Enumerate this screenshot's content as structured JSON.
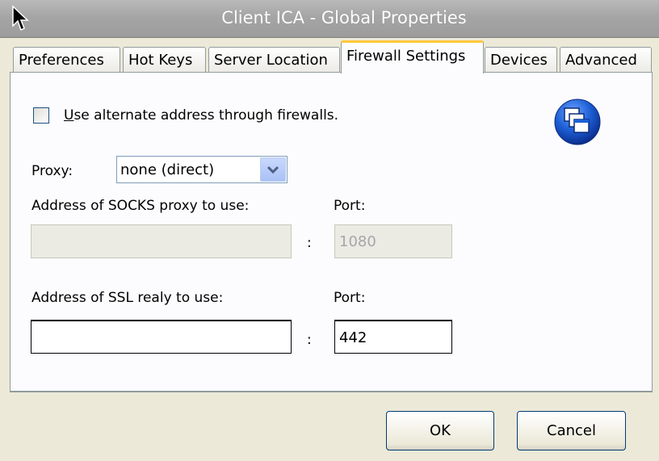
{
  "window": {
    "title": "Client ICA - Global Properties"
  },
  "tabs": [
    {
      "label": "Preferences"
    },
    {
      "label": "Hot Keys"
    },
    {
      "label": "Server Location"
    },
    {
      "label": "Firewall Settings",
      "active": true
    },
    {
      "label": "Devices"
    },
    {
      "label": "Advanced"
    }
  ],
  "firewall": {
    "alternate_address": {
      "label_key": "U",
      "label_rest": "se alternate address through firewalls.",
      "checked": false
    },
    "proxy": {
      "label": "Proxy:",
      "value": "none (direct)"
    },
    "socks": {
      "label": "Address of SOCKS proxy to use:",
      "address": "",
      "port_label": "Port:",
      "port": "1080",
      "separator": ":"
    },
    "ssl": {
      "label": "Address of SSL realy to use:",
      "address": "",
      "port_label": "Port:",
      "port": "442",
      "separator": ":"
    }
  },
  "buttons": {
    "ok": "OK",
    "cancel": "Cancel"
  },
  "colors": {
    "tab_accent": "#ffc83c",
    "field_border": "#7f9db9",
    "icon_blue": "#1d5fd6",
    "face": "#ece9d8"
  }
}
